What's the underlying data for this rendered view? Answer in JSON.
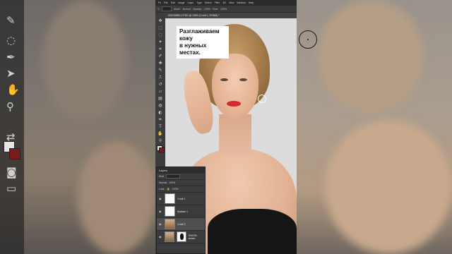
{
  "caption": {
    "line1": "Разглаживаем кожу",
    "line2": "в нужных местах."
  },
  "menu": [
    "Ps",
    "File",
    "Edit",
    "Image",
    "Layer",
    "Type",
    "Select",
    "Filter",
    "3D",
    "View",
    "Window",
    "Help"
  ],
  "options": {
    "mode_label": "Mode:",
    "mode_value": "Normal",
    "opacity_label": "Opacity:",
    "opacity_value": "100%",
    "flow_label": "Flow:",
    "flow_value": "100%"
  },
  "document_tab": "SNG39850-1.PSD @ 126% (Слой 1, RGB/8) *",
  "layers_panel": {
    "tab": "Layers",
    "kind_label": "Kind",
    "blend_mode": "Normal",
    "opacity": "100%",
    "fill": "100%",
    "lock_label": "Lock:",
    "layers": [
      {
        "name": "Слой 1",
        "thumb": "white",
        "active": false
      },
      {
        "name": "Кривые 1",
        "thumb": "white",
        "active": false
      },
      {
        "name": "Слой 3",
        "thumb": "photo",
        "active": true
      },
      {
        "name": "SNG39... копия",
        "thumb": "mask",
        "active": false
      }
    ]
  },
  "colors": {
    "foreground": "#e8e8e8",
    "background": "#7a1c1c",
    "lips": "#d62a2f"
  },
  "icons": [
    "move-icon",
    "marquee-icon",
    "lasso-icon",
    "brush-icon",
    "healing-icon",
    "hand-icon",
    "zoom-icon",
    "eye-icon"
  ]
}
